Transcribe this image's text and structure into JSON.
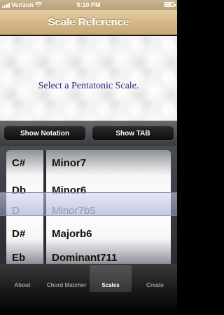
{
  "status_bar": {
    "carrier": "Verizon",
    "time": "5:10 PM"
  },
  "nav": {
    "title": "Scale Reference"
  },
  "content": {
    "prompt": "Select a Pentatonic Scale."
  },
  "buttons": {
    "show_notation": "Show Notation",
    "show_tab": "Show TAB"
  },
  "picker": {
    "keys": [
      "C#",
      "Db",
      "D",
      "D#",
      "Eb"
    ],
    "scales": [
      "Minor7",
      "Minor6",
      "Minor7b5",
      "Majorb6",
      "Dominant711"
    ],
    "selected_key": "D",
    "selected_scale": "Minor7b5"
  },
  "tabs": [
    {
      "label": "About"
    },
    {
      "label": "Chord Matcher"
    },
    {
      "label": "Scales"
    },
    {
      "label": "Create"
    }
  ],
  "colors": {
    "nav_tan": "#d2b485",
    "prompt_text": "#2d2d7a",
    "selected_row_text": "#7f8190"
  }
}
